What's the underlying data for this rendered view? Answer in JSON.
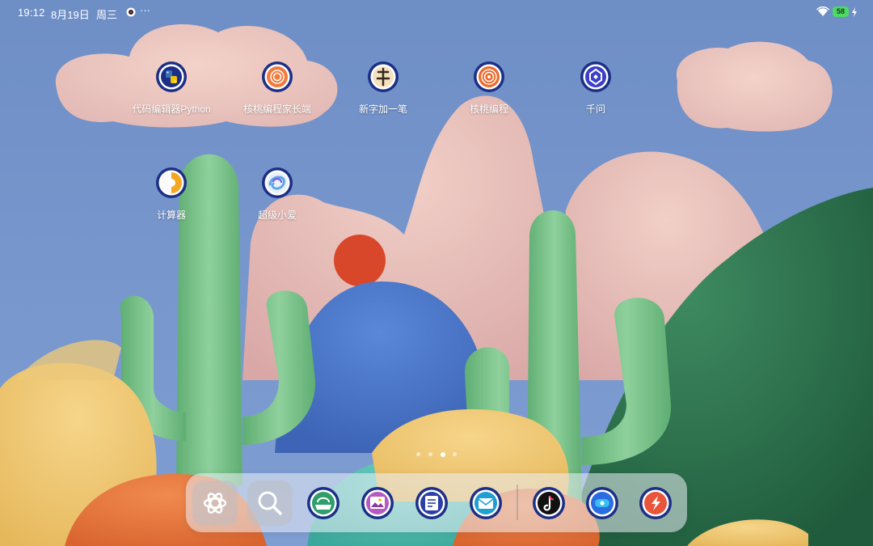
{
  "status_bar": {
    "time": "19:12",
    "date": "8月19日",
    "weekday": "周三",
    "more": "···",
    "battery": "58"
  },
  "home": {
    "apps": [
      {
        "label": "代码编辑器Python",
        "icon": "python-icon"
      },
      {
        "label": "核桃编程家长端",
        "icon": "walnut-parent-icon"
      },
      {
        "label": "新字加一笔",
        "icon": "character-stroke-icon"
      },
      {
        "label": "核桃编程",
        "icon": "walnut-coding-icon"
      },
      {
        "label": "千问",
        "icon": "qianwen-icon"
      },
      {
        "label": "计算器",
        "icon": "calculator-icon"
      },
      {
        "label": "超级小爱",
        "icon": "xiaoai-icon"
      }
    ],
    "page_count": 4,
    "active_page": 3
  },
  "dock": {
    "items": [
      {
        "icon": "ai-assistant-icon"
      },
      {
        "icon": "search-icon"
      },
      {
        "icon": "app-store-icon"
      },
      {
        "icon": "gallery-icon"
      },
      {
        "icon": "notes-icon"
      },
      {
        "icon": "mail-icon"
      },
      {
        "icon": "tiktok-icon"
      },
      {
        "icon": "top-icon"
      },
      {
        "icon": "app-recent-icon"
      }
    ]
  },
  "colors": {
    "sky": "#6f8fc7",
    "icon_ring": "#1c2f86",
    "cactus": "#7dc08b",
    "hill_dark": "#2f7a52"
  }
}
